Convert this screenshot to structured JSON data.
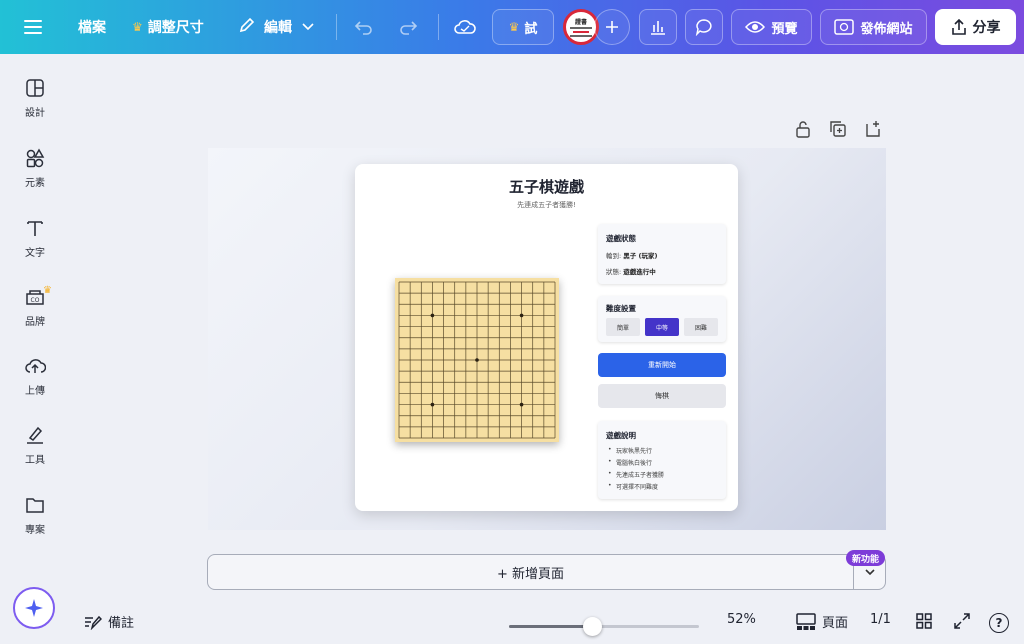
{
  "topbar": {
    "file_label": "檔案",
    "resize_label": "調整尺寸",
    "edit_label": "編輯",
    "trial_label": "試",
    "preview_label": "預覽",
    "publish_label": "發佈網站",
    "share_label": "分享",
    "avatar_text": "證書"
  },
  "sidebar": {
    "items": [
      {
        "label": "設計",
        "icon": "layout-icon"
      },
      {
        "label": "元素",
        "icon": "shapes-icon"
      },
      {
        "label": "文字",
        "icon": "text-icon"
      },
      {
        "label": "品牌",
        "icon": "brand-icon"
      },
      {
        "label": "上傳",
        "icon": "upload-cloud-icon"
      },
      {
        "label": "工具",
        "icon": "draw-tool-icon"
      },
      {
        "label": "專案",
        "icon": "folder-icon"
      }
    ]
  },
  "game": {
    "title": "五子棋遊戲",
    "subtitle": "先連成五子者獲勝!",
    "status": {
      "heading": "遊戲狀態",
      "turn_label": "輪到:",
      "turn_value": "黑子 (玩家)",
      "state_label": "狀態:",
      "state_value": "遊戲進行中"
    },
    "difficulty": {
      "heading": "難度設置",
      "options": [
        "簡單",
        "中等",
        "困難"
      ],
      "selected": "中等"
    },
    "restart_label": "重新開始",
    "undo_label": "悔棋",
    "rules": {
      "heading": "遊戲說明",
      "items": [
        "玩家執黑先行",
        "電腦執白後行",
        "先連成五子者獲勝",
        "可選擇不同難度"
      ]
    },
    "board": {
      "lines": 15,
      "star_points": [
        [
          3,
          3
        ],
        [
          3,
          11
        ],
        [
          7,
          7
        ],
        [
          11,
          3
        ],
        [
          11,
          11
        ]
      ]
    }
  },
  "canvas": {
    "add_page_label": "+ 新增頁面",
    "new_feature_badge": "新功能"
  },
  "bottombar": {
    "notes_label": "備註",
    "zoom_value": "52%",
    "zoom_fraction": 0.52,
    "pages_label": "頁面",
    "page_count": "1/1",
    "help_label": "?"
  }
}
